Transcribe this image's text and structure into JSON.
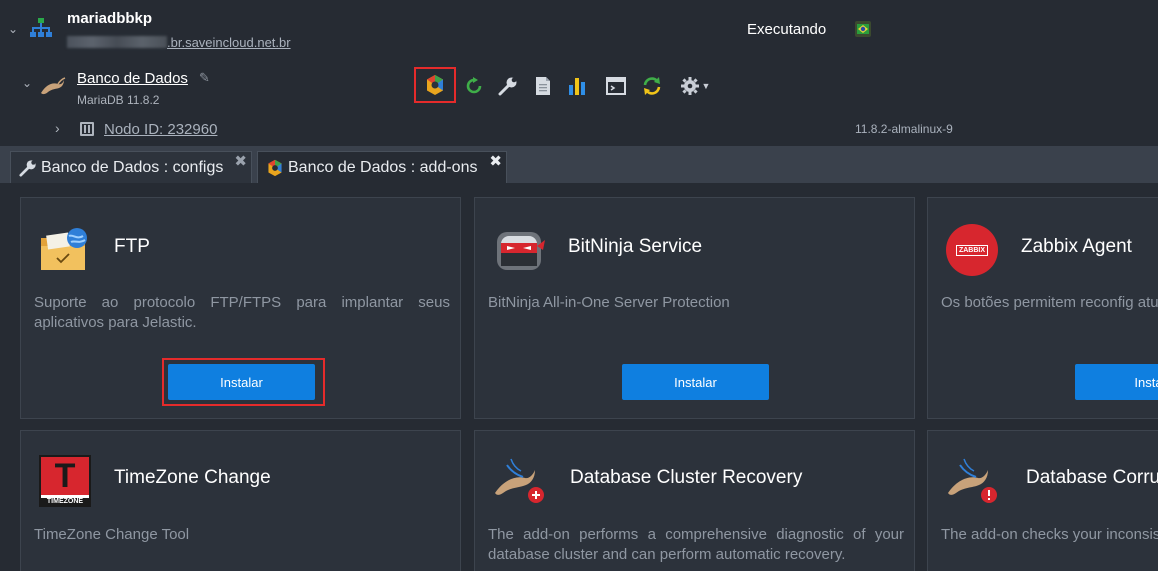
{
  "environment": {
    "name": "mariadbbkp",
    "domain_suffix": ".br.saveincloud.net.br",
    "status": "Executando"
  },
  "node_group": {
    "name": "Banco de Dados",
    "subtitle": "MariaDB 11.8.2",
    "toolbar_icons": [
      "add-ons-icon",
      "restart-icon",
      "config-icon",
      "log-icon",
      "statistics-icon",
      "web-ssh-icon",
      "redeploy-icon",
      "settings-icon"
    ]
  },
  "node": {
    "id_label": "Nodo ID: 232960",
    "version": "11.8.2-almalinux-9"
  },
  "tabs": [
    {
      "label": "Banco de Dados : configs",
      "icon": "wrench-icon",
      "active": false
    },
    {
      "label": "Banco de Dados : add-ons",
      "icon": "add-ons-icon",
      "active": true
    }
  ],
  "addons": [
    {
      "title": "FTP",
      "description": "Suporte ao protocolo FTP/FTPS para implantar seus aplicativos para Jelastic.",
      "button": "Instalar",
      "icon": "ftp-folder-icon"
    },
    {
      "title": "BitNinja Service",
      "description": "BitNinja All-in-One Server Protection",
      "button": "Instalar",
      "icon": "bitninja-icon"
    },
    {
      "title": "Zabbix Agent",
      "description": "Os botões permitem reconfig atualizá-lo",
      "button": "Insta",
      "icon": "zabbix-icon",
      "icon_text": "ZABBIX"
    },
    {
      "title": "TimeZone Change",
      "description": "TimeZone Change Tool",
      "icon": "timezone-icon",
      "icon_text": "TIMEZONE"
    },
    {
      "title": "Database Cluster Recovery",
      "description": "The add-on performs a comprehensive diagnostic of your database cluster and can perform automatic recovery.",
      "icon": "mariadb-recovery-icon"
    },
    {
      "title": "Database Corru",
      "description": "The add-on checks your inconsistent data in the compor",
      "icon": "mariadb-corruption-icon"
    }
  ],
  "colors": {
    "accent": "#0f7fe0",
    "highlight": "#e52b2b",
    "background": "#262b33",
    "card": "#2c323b"
  }
}
